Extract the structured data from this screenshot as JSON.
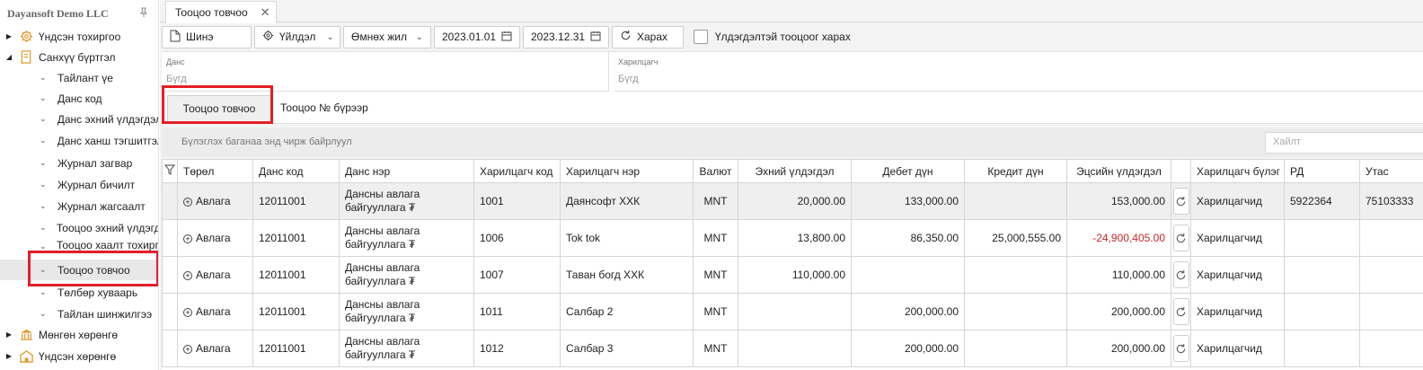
{
  "sidebar": {
    "company": "Dayansoft Demo LLC",
    "items": [
      {
        "label": "Үндсэн тохиргоо",
        "icon": "gear-icon",
        "level": 0,
        "expanded": false
      },
      {
        "label": "Санхүү бүртгэл",
        "icon": "book-icon",
        "level": 0,
        "expanded": true
      },
      {
        "label": "Тайлант үе",
        "level": 1
      },
      {
        "label": "Данс код",
        "level": 1
      },
      {
        "label": "Данс эхний үлдэгдэл",
        "level": 1
      },
      {
        "label": "Данс ханш тэгшитгэл",
        "level": 1
      },
      {
        "label": "Журнал загвар",
        "level": 1
      },
      {
        "label": "Журнал бичилт",
        "level": 1
      },
      {
        "label": "Журнал жагсаалт",
        "level": 1
      },
      {
        "label": "Тооцоо эхний үлдэгдэл",
        "level": 1
      },
      {
        "label": "Тооцоо хаалт тохиргоо",
        "level": 1
      },
      {
        "label": "Тооцоо товчоо",
        "level": 1,
        "selected": true
      },
      {
        "label": "Төлбөр хуваарь",
        "level": 1
      },
      {
        "label": "Тайлан шинжилгээ",
        "level": 1
      },
      {
        "label": "Мөнгөн хөрөнгө",
        "icon": "bank-icon",
        "level": 0,
        "expanded": false
      },
      {
        "label": "Үндсэн хөрөнгө",
        "icon": "building-icon",
        "level": 0,
        "expanded": false
      }
    ]
  },
  "tab": {
    "label": "Тооцоо товчоо"
  },
  "toolbar": {
    "new_label": "Шинэ",
    "actions_label": "Үйлдэл",
    "period_label": "Өмнөх жил",
    "date_from": "2023.01.01",
    "date_to": "2023.12.31",
    "view_label": "Харах",
    "balance_checkbox_label": "Үлдэгдэлтэй тооцоог харах"
  },
  "filters": {
    "account_label": "Данс",
    "account_value": "Бүгд",
    "partner_label": "Харилцагч",
    "partner_value": "Бүгд"
  },
  "subtabs": {
    "summary": "Тооцоо товчоо",
    "by_number": "Тооцоо № бүрээр"
  },
  "grid": {
    "group_hint": "Бүлэглэх баганаа энд чирж байрлуул",
    "search_placeholder": "Хайлт",
    "columns": [
      "Төрөл",
      "Данс код",
      "Данс нэр",
      "Харилцагч код",
      "Харилцагч нэр",
      "Валют",
      "Эхний үлдэгдэл",
      "Дебет дүн",
      "Кредит дүн",
      "Эцсийн үлдэгдэл",
      "",
      "Харилцагч бүлэг",
      "РД",
      "Утас"
    ],
    "rows": [
      {
        "type": "Авлага",
        "acc_code": "12011001",
        "acc_name": "Дансны авлага байгууллага ₮",
        "partner_code": "1001",
        "partner_name": "Даянсофт ХХК",
        "currency": "MNT",
        "opening": "20,000.00",
        "debit": "133,000.00",
        "credit": "",
        "closing": "153,000.00",
        "closing_negative": false,
        "group": "Харилцагчид",
        "rd": "5922364",
        "phone": "75103333"
      },
      {
        "type": "Авлага",
        "acc_code": "12011001",
        "acc_name": "Дансны авлага байгууллага ₮",
        "partner_code": "1006",
        "partner_name": "Tok tok",
        "currency": "MNT",
        "opening": "13,800.00",
        "debit": "86,350.00",
        "credit": "25,000,555.00",
        "closing": "-24,900,405.00",
        "closing_negative": true,
        "group": "Харилцагчид",
        "rd": "",
        "phone": ""
      },
      {
        "type": "Авлага",
        "acc_code": "12011001",
        "acc_name": "Дансны авлага байгууллага ₮",
        "partner_code": "1007",
        "partner_name": "Таван богд ХХК",
        "currency": "MNT",
        "opening": "110,000.00",
        "debit": "",
        "credit": "",
        "closing": "110,000.00",
        "closing_negative": false,
        "group": "Харилцагчид",
        "rd": "",
        "phone": ""
      },
      {
        "type": "Авлага",
        "acc_code": "12011001",
        "acc_name": "Дансны авлага байгууллага ₮",
        "partner_code": "1011",
        "partner_name": "Салбар 2",
        "currency": "MNT",
        "opening": "",
        "debit": "200,000.00",
        "credit": "",
        "closing": "200,000.00",
        "closing_negative": false,
        "group": "Харилцагчид",
        "rd": "",
        "phone": ""
      },
      {
        "type": "Авлага",
        "acc_code": "12011001",
        "acc_name": "Дансны авлага байгууллага ₮",
        "partner_code": "1012",
        "partner_name": "Салбар 3",
        "currency": "MNT",
        "opening": "",
        "debit": "200,000.00",
        "credit": "",
        "closing": "200,000.00",
        "closing_negative": false,
        "group": "Харилцагчид",
        "rd": "",
        "phone": ""
      }
    ]
  },
  "colors": {
    "highlight": "#e41e26",
    "negative": "#c62828",
    "icon_orange": "#e09a2b"
  }
}
